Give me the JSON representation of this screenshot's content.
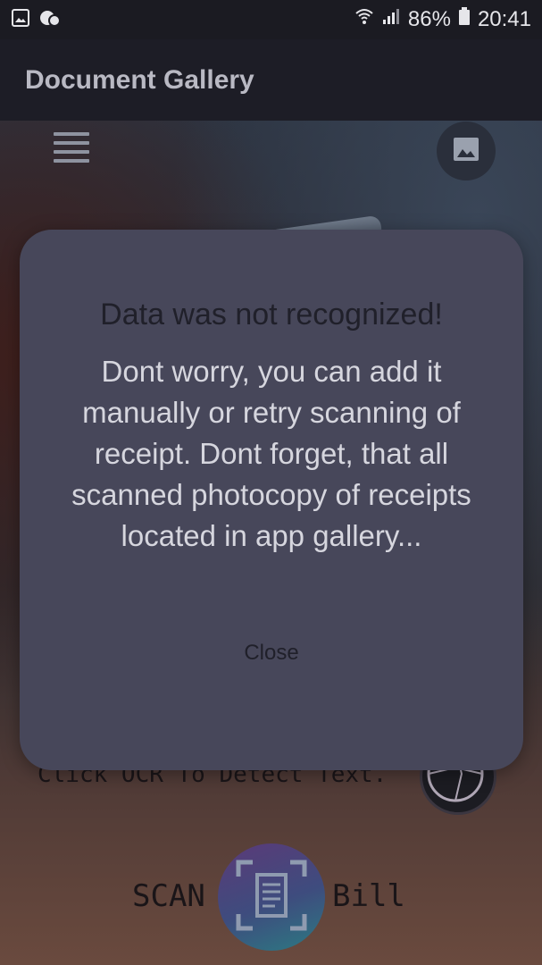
{
  "status_bar": {
    "left_icons": [
      "image-icon",
      "notification-icon"
    ],
    "wifi": "wifi-icon",
    "signal": "signal-icon",
    "battery_percent": "86%",
    "time": "20:41"
  },
  "appbar": {
    "title": "Document Gallery"
  },
  "main": {
    "ocr_hint": "Click OCR To Detect Text.",
    "scan_left_label": "SCAN",
    "scan_right_label": "Bill"
  },
  "dialog": {
    "title": "Data was not recognized!",
    "message": "Dont worry, you can add it manually or retry scanning of receipt. Dont forget, that all scanned photocopy of receipts located in app gallery...",
    "close_label": "Close"
  },
  "colors": {
    "dialog_bg": "#47475a",
    "appbar_bg": "#1d1d26"
  }
}
